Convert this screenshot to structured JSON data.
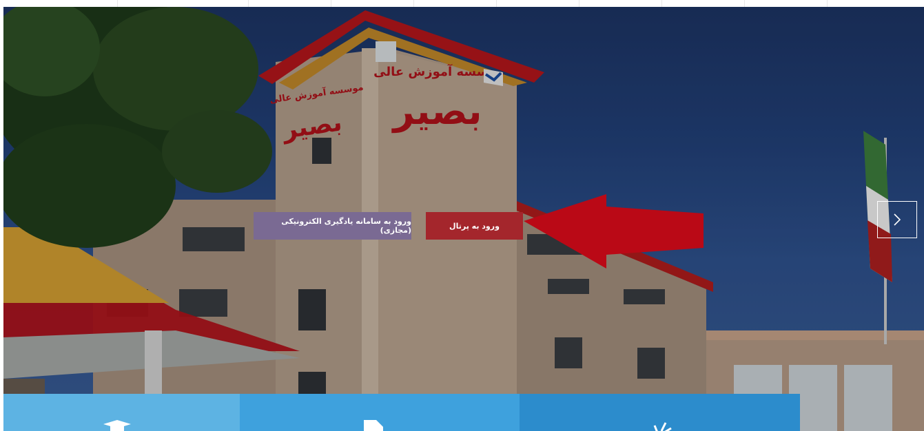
{
  "slider": {
    "buttons": {
      "lms_label": "ورود به سامانه یادگیری الکترونیکی (مجازی)",
      "portal_label": "ورود به پرتال"
    },
    "next_icon": "chevron-right-icon",
    "building_sign": {
      "line1": "موسسه آموزش عالی",
      "line2": "بصیر"
    }
  },
  "cards": [
    {
      "icon": "graduation-cap-icon",
      "color": "#5db3e3"
    },
    {
      "icon": "document-icon",
      "color": "#3ea1dd"
    },
    {
      "icon": "rays-icon",
      "color": "#2c8ccc"
    }
  ],
  "colors": {
    "portal_button": "#a4262c",
    "lms_button": "#7a6a93",
    "annotation_arrow": "#e30b1c"
  }
}
